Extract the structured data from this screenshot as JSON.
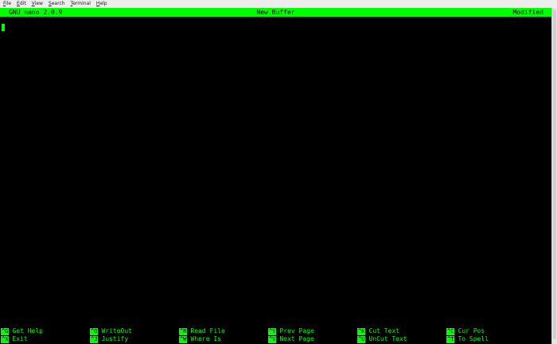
{
  "menubar": {
    "items": [
      {
        "mnemonic": "F",
        "rest": "ile"
      },
      {
        "mnemonic": "E",
        "rest": "dit"
      },
      {
        "mnemonic": "V",
        "rest": "iew"
      },
      {
        "mnemonic": "S",
        "rest": "earch"
      },
      {
        "mnemonic": "T",
        "rest": "erminal"
      },
      {
        "mnemonic": "H",
        "rest": "elp"
      }
    ]
  },
  "nano": {
    "version": "GNU nano 2.0.9",
    "buffer_name": "New Buffer",
    "status": "Modified"
  },
  "shortcuts": {
    "row1": [
      {
        "key": "^G",
        "label": "Get Help"
      },
      {
        "key": "^O",
        "label": "WriteOut"
      },
      {
        "key": "^R",
        "label": "Read File"
      },
      {
        "key": "^Y",
        "label": "Prev Page"
      },
      {
        "key": "^K",
        "label": "Cut Text"
      },
      {
        "key": "^C",
        "label": "Cur Pos"
      }
    ],
    "row2": [
      {
        "key": "^X",
        "label": "Exit"
      },
      {
        "key": "^J",
        "label": "Justify"
      },
      {
        "key": "^W",
        "label": "Where Is"
      },
      {
        "key": "^V",
        "label": "Next Page"
      },
      {
        "key": "^U",
        "label": "UnCut Text"
      },
      {
        "key": "^T",
        "label": "To Spell"
      }
    ]
  },
  "colors": {
    "terminal_bg": "#000000",
    "terminal_fg": "#00ff00",
    "menubar_bg": "#ededed"
  }
}
